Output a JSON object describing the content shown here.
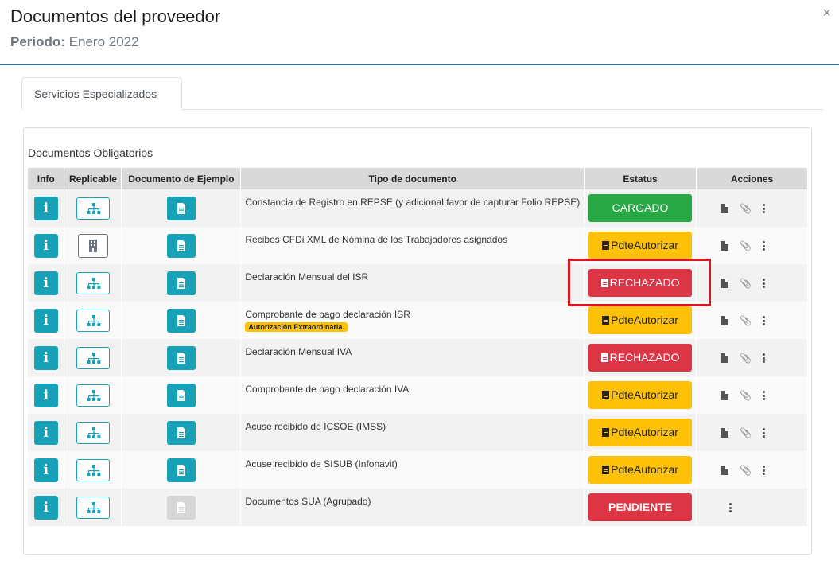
{
  "header": {
    "title": "Documentos del proveedor",
    "period_label": "Periodo:",
    "period_value": "Enero 2022",
    "close_label": "×"
  },
  "tabs": [
    {
      "label": "Servicios Especializados"
    }
  ],
  "card": {
    "title": "Documentos Obligatorios"
  },
  "columns": [
    "Info",
    "Replicable",
    "Documento de Ejemplo",
    "Tipo de documento",
    "Estatus",
    "Acciones"
  ],
  "rows": [
    {
      "tipo": "Constancia de Registro en REPSE (y adicional favor de capturar Folio REPSE)",
      "status": "CARGADO",
      "status_type": "cargado",
      "replicable": "sitemap",
      "doc_enabled": true,
      "actions": "full"
    },
    {
      "tipo": "Recibos CFDi XML de Nómina de los Trabajadores asignados",
      "status": "PdteAutorizar",
      "status_type": "pdte",
      "replicable": "building",
      "doc_enabled": true,
      "actions": "full"
    },
    {
      "tipo": "Declaración Mensual del ISR",
      "status": "RECHAZADO",
      "status_type": "rech",
      "replicable": "sitemap",
      "doc_enabled": true,
      "actions": "full"
    },
    {
      "tipo": "Comprobante de pago declaración ISR",
      "badge": "Autorización Extraordinaria.",
      "status": "PdteAutorizar",
      "status_type": "pdte",
      "replicable": "sitemap",
      "doc_enabled": true,
      "actions": "full"
    },
    {
      "tipo": "Declaración Mensual IVA",
      "status": "RECHAZADO",
      "status_type": "rech",
      "replicable": "sitemap",
      "doc_enabled": true,
      "actions": "full"
    },
    {
      "tipo": "Comprobante de pago declaración IVA",
      "status": "PdteAutorizar",
      "status_type": "pdte",
      "replicable": "sitemap",
      "doc_enabled": true,
      "actions": "full"
    },
    {
      "tipo": "Acuse recibido de ICSOE (IMSS)",
      "status": "PdteAutorizar",
      "status_type": "pdte",
      "replicable": "sitemap",
      "doc_enabled": true,
      "actions": "full"
    },
    {
      "tipo": "Acuse recibido de SISUB (Infonavit)",
      "status": "PdteAutorizar",
      "status_type": "pdte",
      "replicable": "sitemap",
      "doc_enabled": true,
      "actions": "full"
    },
    {
      "tipo": "Documentos SUA (Agrupado)",
      "status": "PENDIENTE",
      "status_type": "pend",
      "replicable": "sitemap",
      "doc_enabled": false,
      "actions": "menu"
    }
  ],
  "colors": {
    "info": "#17a2b8",
    "cargado": "#28a745",
    "pdte": "#ffc107",
    "rech": "#dc3545",
    "highlight": "#d9171f"
  }
}
